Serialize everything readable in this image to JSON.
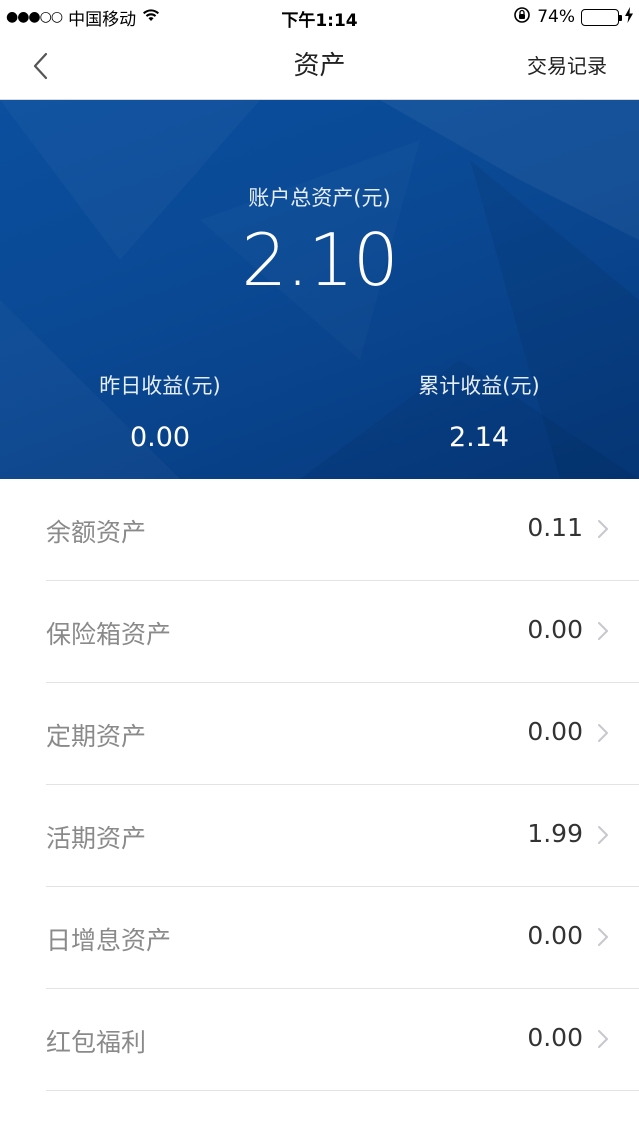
{
  "status_bar": {
    "signal": "●●●○○",
    "carrier": "中国移动",
    "time": "下午1:14",
    "battery": "74%",
    "battery_level": 0.74
  },
  "nav": {
    "title": "资产",
    "right_label": "交易记录"
  },
  "summary": {
    "total_label": "账户总资产(元)",
    "total_value": "2.10",
    "yesterday_label": "昨日收益(元)",
    "yesterday_value": "0.00",
    "cumulative_label": "累计收益(元)",
    "cumulative_value": "2.14"
  },
  "assets": [
    {
      "label": "余额资产",
      "value": "0.11"
    },
    {
      "label": "保险箱资产",
      "value": "0.00"
    },
    {
      "label": "定期资产",
      "value": "0.00"
    },
    {
      "label": "活期资产",
      "value": "1.99"
    },
    {
      "label": "日增息资产",
      "value": "0.00"
    },
    {
      "label": "红包福利",
      "value": "0.00"
    }
  ],
  "colors": {
    "hero_blue": "#0a4893",
    "battery": "#f5c400"
  }
}
